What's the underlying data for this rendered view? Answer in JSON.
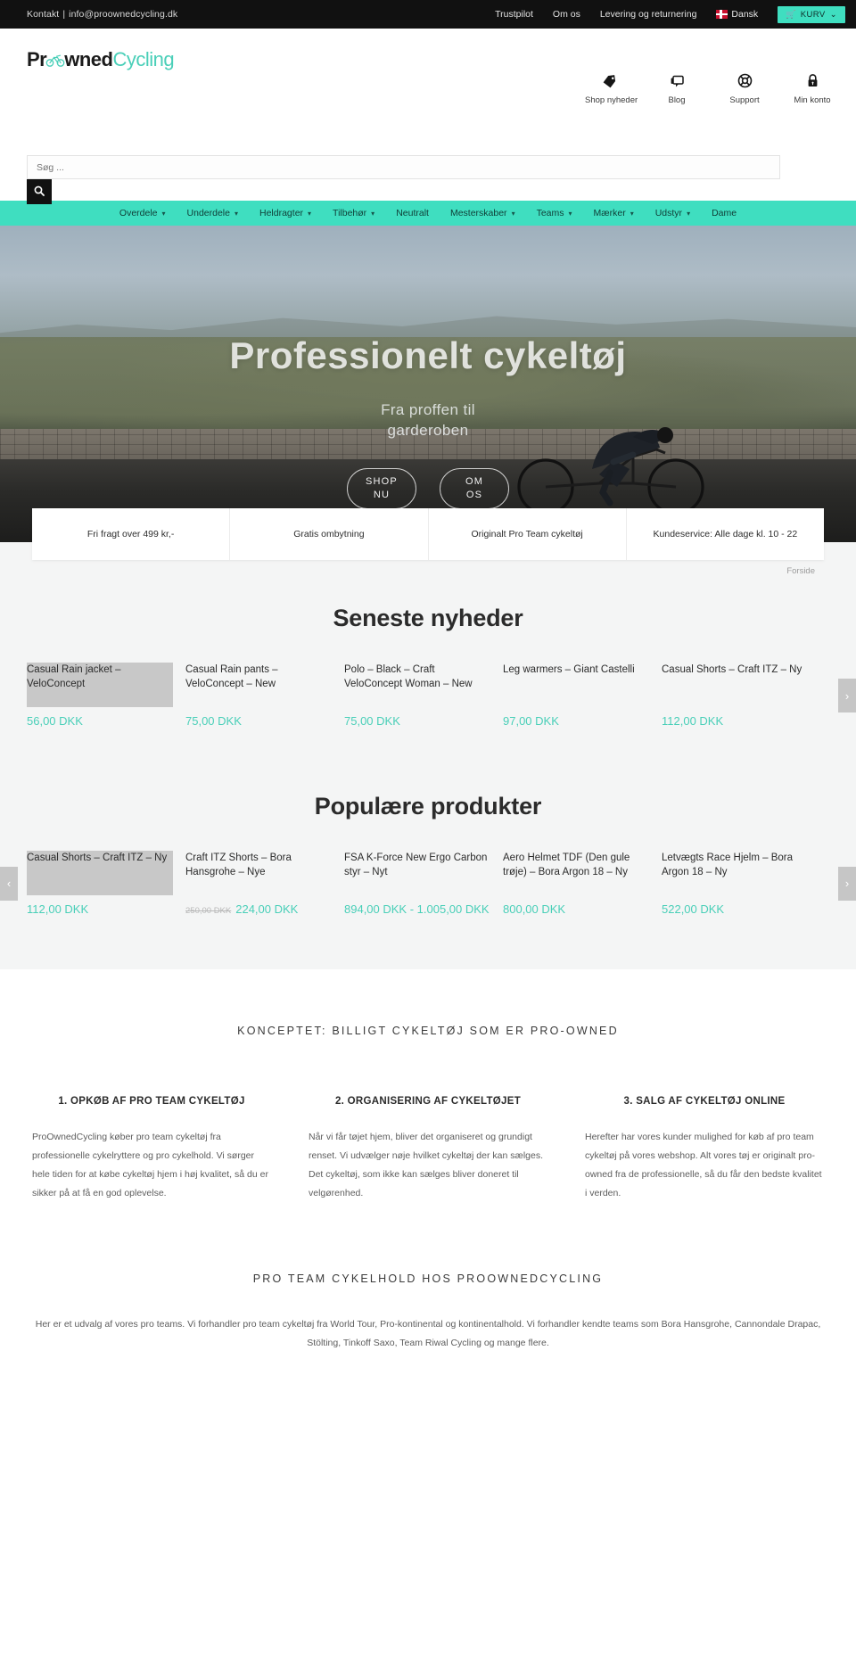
{
  "topbar": {
    "contact_label": "Kontakt",
    "separator": "|",
    "email": "info@proownedcycling.dk",
    "links": [
      "Trustpilot",
      "Om os",
      "Levering og returnering"
    ],
    "language": "Dansk",
    "cart_label": "KURV",
    "cart_icon": "cart-icon",
    "caret": "⌄",
    "accent": "#3fdec0",
    "background": "#111111"
  },
  "header": {
    "logo": {
      "part1": "Pr",
      "icon": "bicycle-icon",
      "part2": "wned",
      "part3": "Cycling"
    },
    "icons": [
      {
        "name": "tag-icon",
        "glyph": "🏷",
        "label": "Shop nyheder"
      },
      {
        "name": "blog-icon",
        "glyph": "🗩",
        "label": "Blog"
      },
      {
        "name": "lifebuoy-icon",
        "glyph": "◎",
        "label": "Support"
      },
      {
        "name": "lock-icon",
        "glyph": "🔒",
        "label": "Min konto"
      }
    ]
  },
  "search": {
    "placeholder": "Søg ...",
    "value": "",
    "button_icon": "search-icon"
  },
  "nav": [
    {
      "label": "Overdele",
      "caret": true
    },
    {
      "label": "Underdele",
      "caret": true
    },
    {
      "label": "Heldragter",
      "caret": true
    },
    {
      "label": "Tilbehør",
      "caret": true
    },
    {
      "label": "Neutralt",
      "caret": false
    },
    {
      "label": "Mesterskaber",
      "caret": true
    },
    {
      "label": "Teams",
      "caret": true
    },
    {
      "label": "Mærker",
      "caret": true
    },
    {
      "label": "Udstyr",
      "caret": true
    },
    {
      "label": "Dame",
      "caret": false
    }
  ],
  "hero": {
    "title": "Professionelt cykeltøj",
    "subtitle_line1": "Fra proffen til",
    "subtitle_line2": "garderoben",
    "button_shop_line1": "SHOP",
    "button_shop_line2": "NU",
    "button_about_line1": "OM",
    "button_about_line2": "OS"
  },
  "features": [
    "Fri fragt over 499 kr,-",
    "Gratis ombytning",
    "Originalt Pro Team cykeltøj",
    "Kundeservice: Alle dage kl. 10 - 22"
  ],
  "breadcrumb": "Forside",
  "news": {
    "title": "Seneste nyheder",
    "prev_icon": "chevron-left-icon",
    "next_icon": "chevron-right-icon",
    "products": [
      {
        "title": "Casual Rain jacket – VeloConcept",
        "price": "56,00 DKK",
        "old_price": ""
      },
      {
        "title": "Casual Rain pants – VeloConcept – New",
        "price": "75,00 DKK",
        "old_price": ""
      },
      {
        "title": "Polo – Black – Craft VeloConcept Woman – New",
        "price": "75,00 DKK",
        "old_price": ""
      },
      {
        "title": "Leg warmers – Giant Castelli",
        "price": "97,00 DKK",
        "old_price": ""
      },
      {
        "title": "Casual Shorts – Craft ITZ – Ny",
        "price": "112,00 DKK",
        "old_price": ""
      }
    ]
  },
  "popular": {
    "title": "Populære produkter",
    "prev_icon": "chevron-left-icon",
    "next_icon": "chevron-right-icon",
    "products": [
      {
        "title": "Casual Shorts – Craft ITZ – Ny",
        "price": "112,00 DKK",
        "old_price": ""
      },
      {
        "title": "Craft ITZ Shorts – Bora Hansgrohe – Nye",
        "price": "224,00 DKK",
        "old_price": "250,00 DKK"
      },
      {
        "title": "FSA K-Force New Ergo Carbon styr – Nyt",
        "price": "894,00 DKK - 1.005,00 DKK",
        "old_price": ""
      },
      {
        "title": "Aero Helmet TDF (Den gule trøje) – Bora Argon 18 – Ny",
        "price": "800,00 DKK",
        "old_price": ""
      },
      {
        "title": "Letvægts Race Hjelm – Bora Argon 18 – Ny",
        "price": "522,00 DKK",
        "old_price": ""
      }
    ]
  },
  "concept": {
    "heading": "KONCEPTET: BILLIGT CYKELTØJ SOM ER PRO-OWNED",
    "columns": [
      {
        "heading": "1. OPKØB AF PRO TEAM CYKELTØJ",
        "body": "ProOwnedCycling køber pro team cykeltøj fra professionelle cykelryttere og pro cykelhold. Vi sørger hele tiden for at købe cykeltøj hjem i høj kvalitet, så du er sikker på at få en god oplevelse."
      },
      {
        "heading": "2. ORGANISERING AF CYKELTØJET",
        "body": "Når vi får tøjet hjem, bliver det organiseret og grundigt renset. Vi udvælger nøje hvilket cykeltøj der kan sælges. Det cykeltøj, som ikke kan sælges bliver doneret til velgørenhed."
      },
      {
        "heading": "3. SALG AF CYKELTØJ ONLINE",
        "body": "Herefter har vores kunder mulighed for køb af pro team cykeltøj på vores webshop. Alt vores tøj er originalt pro-owned fra de professionelle, så du får den bedste kvalitet i verden."
      }
    ]
  },
  "teams": {
    "heading": "PRO TEAM CYKELHOLD HOS PROOWNEDCYCLING",
    "body": "Her er et udvalg af vores pro teams. Vi forhandler pro team cykeltøj fra World Tour, Pro-kontinental og kontinentalhold. Vi forhandler kendte teams som Bora Hansgrohe, Cannondale Drapac, Stölting, Tinkoff Saxo, Team Riwal Cycling og mange flere."
  }
}
